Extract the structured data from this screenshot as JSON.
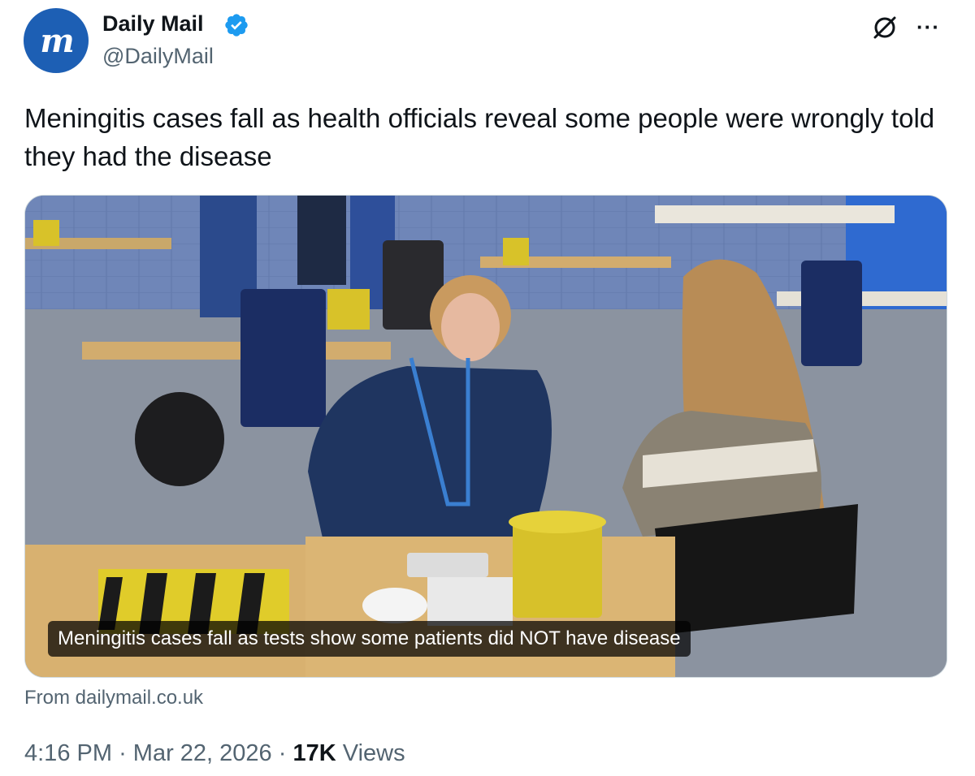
{
  "account": {
    "avatar_letters": "m",
    "display_name": "Daily Mail",
    "handle": "@DailyMail",
    "verified": true,
    "verified_color": "#1d9bf0",
    "avatar_color": "#1d5fb4"
  },
  "header_icons": [
    "grok-icon",
    "more-icon"
  ],
  "more_label": "···",
  "tweet": {
    "text": "Meningitis cases fall as health officials reveal some people were wrongly told they had the disease"
  },
  "card": {
    "caption": "Meningitis cases fall as tests show some patients did NOT have disease",
    "source": "From dailymail.co.uk"
  },
  "meta": {
    "time": "4:16 PM",
    "separator": "·",
    "date": "Mar 22, 2026",
    "views_count": "17K",
    "views_label": "Views"
  }
}
